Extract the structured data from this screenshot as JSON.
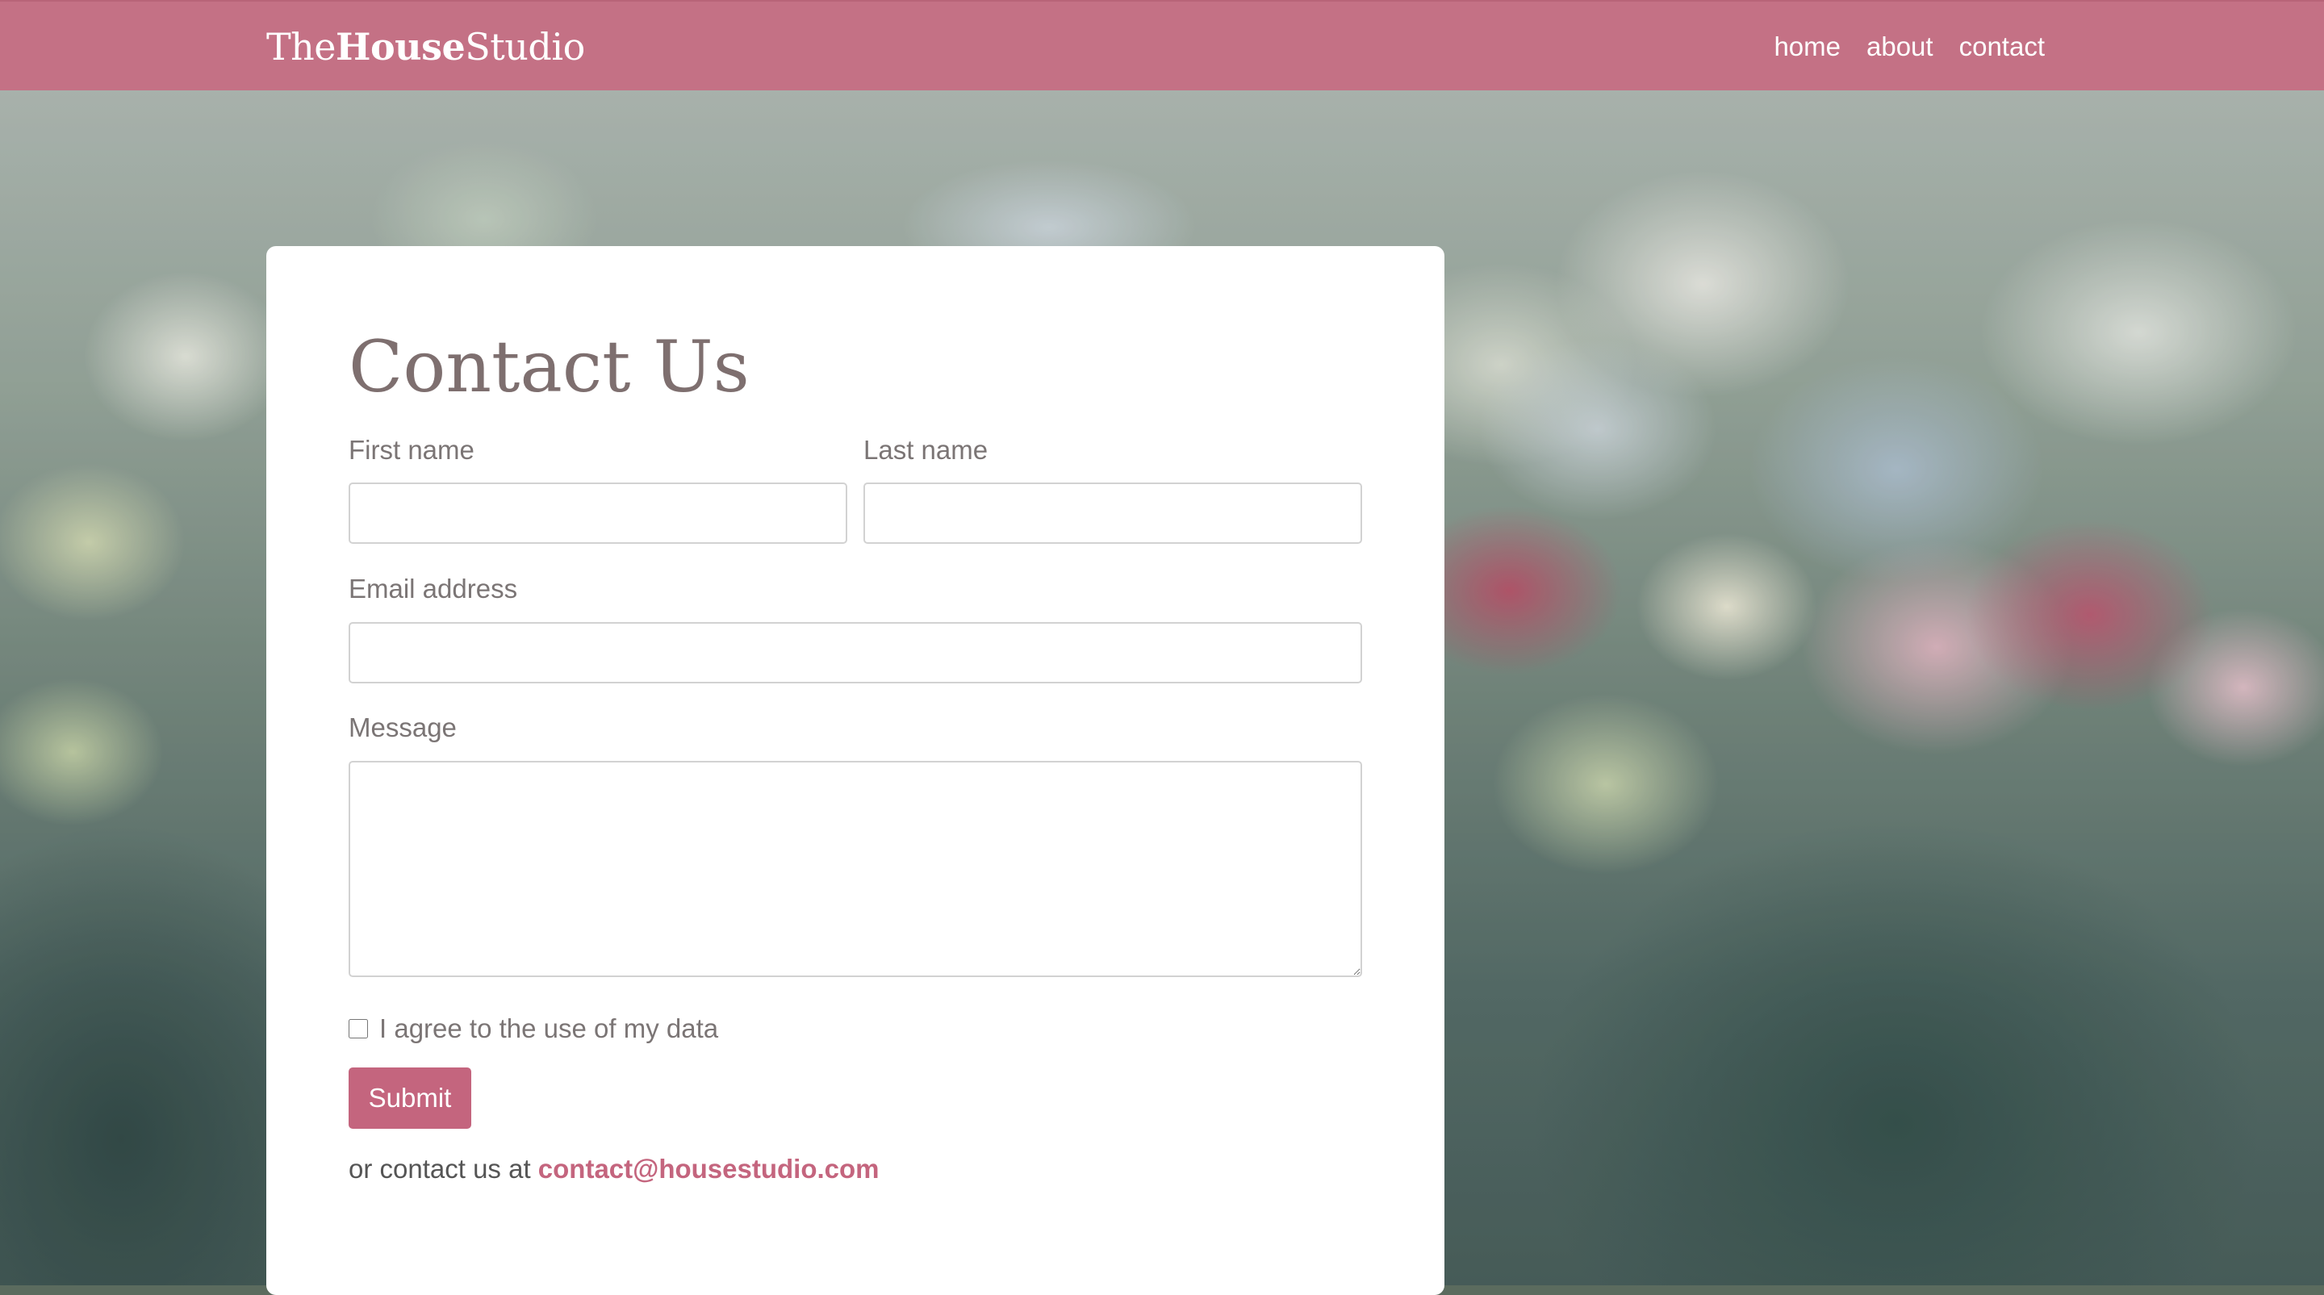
{
  "brand": {
    "part1": "The",
    "part2": "House",
    "part3": "Studio"
  },
  "nav": {
    "items": [
      "home",
      "about",
      "contact"
    ]
  },
  "form": {
    "title": "Contact Us",
    "first_name_label": "First name",
    "first_name_value": "",
    "last_name_label": "Last name",
    "last_name_value": "",
    "email_label": "Email address",
    "email_value": "",
    "message_label": "Message",
    "message_value": "",
    "consent_label": "I agree to the use of my data",
    "consent_checked": false,
    "submit_label": "Submit",
    "alt_contact_prefix": "or contact us at ",
    "alt_contact_email": "contact@housestudio.com"
  },
  "colors": {
    "primary": "#c47185",
    "button": "#c4657e",
    "title_text": "#7e6f6f",
    "label_text": "#7b7575"
  }
}
